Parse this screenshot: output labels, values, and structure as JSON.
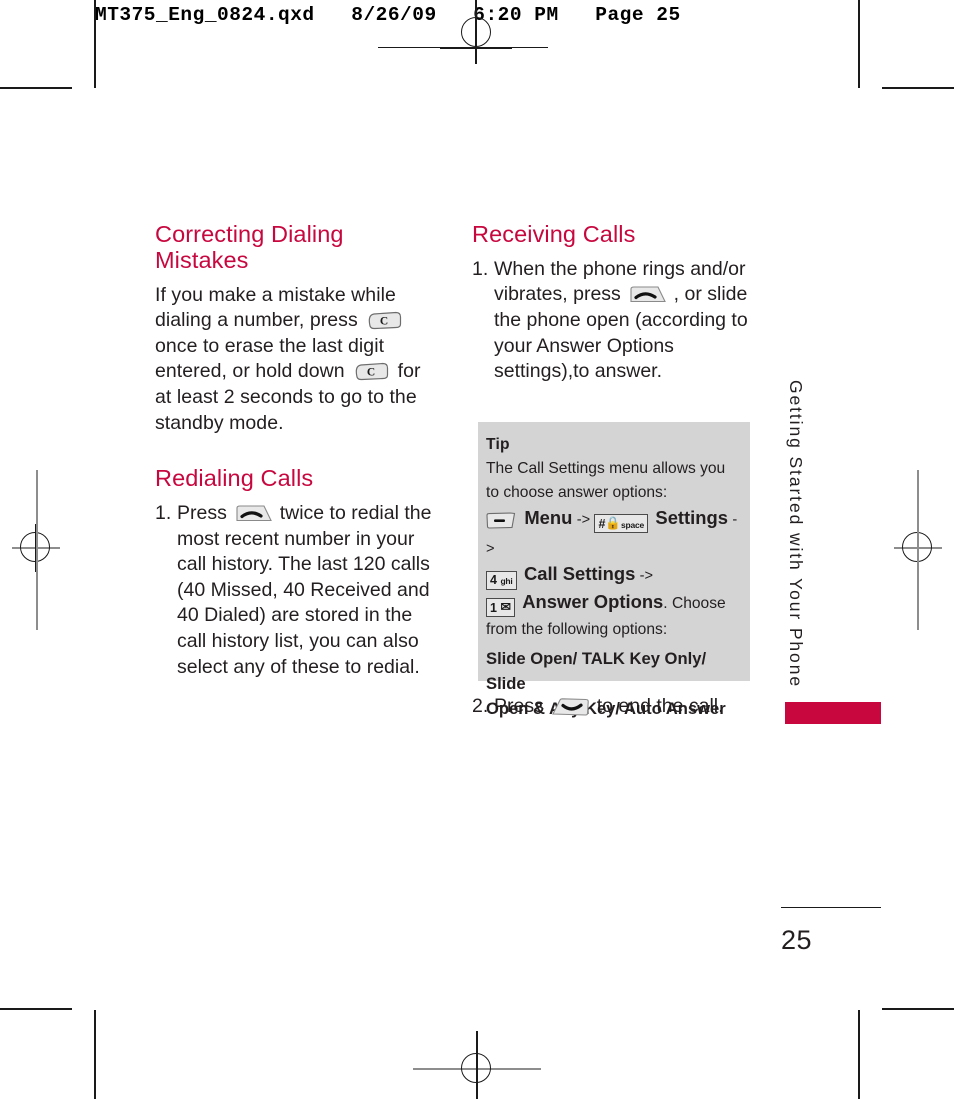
{
  "prepress": {
    "slug_text": "MT375_Eng_0824.qxd   8/26/09   6:20 PM   Page 25"
  },
  "left_column": {
    "heading_1": "Correcting Dialing Mistakes",
    "paragraph_1_part_a": "If you make a mistake while dialing a number, press",
    "paragraph_1_part_b": "once to erase the last digit entered, or hold down",
    "paragraph_1_part_c": "for at least 2 seconds to go to the standby mode.",
    "heading_2": "Redialing Calls",
    "step_1_number": "1.",
    "step_1_part_a": "Press",
    "step_1_part_b": "twice to redial the most recent number in your call history. The last 120 calls (40 Missed, 40 Received and 40 Dialed) are stored in the call history list, you can also select any of these to redial."
  },
  "right_column": {
    "heading_1": "Receiving Calls",
    "step_1_number": "1.",
    "step_1_part_a": "When the phone rings and/or vibrates, press",
    "step_1_part_b": ", or slide the phone open (according to your Answer Options settings),to answer.",
    "step_2_number": "2.",
    "step_2_part_a": "Press",
    "step_2_part_b": "to end the call."
  },
  "tip_box": {
    "title": "Tip",
    "intro": "The Call Settings menu allows you to choose answer options:",
    "path": [
      {
        "key_label": "menu-key",
        "label": "Menu",
        "arrow": "->"
      },
      {
        "key_digit": "#",
        "key_sub": "space",
        "label": "Settings",
        "arrow": "->"
      },
      {
        "key_digit": "4",
        "key_sub": "ghi",
        "label": "Call Settings",
        "arrow": "->"
      },
      {
        "key_digit": "1",
        "key_sub": "voicemail",
        "label": "Answer Options",
        "arrow": ""
      }
    ],
    "after_path": ". Choose",
    "tail": "from the following options:",
    "options_line_1": "Slide Open/ TALK Key Only/ Slide",
    "options_line_2": "Open & Any Key/ Auto Answer"
  },
  "side_tab": {
    "label": "Getting Started with Your Phone",
    "accent_color": "#c8073f"
  },
  "folio": {
    "page_number": "25"
  },
  "colors": {
    "heading": "#c8073f",
    "body": "#231f20",
    "tip_background": "#d4d4d4"
  }
}
